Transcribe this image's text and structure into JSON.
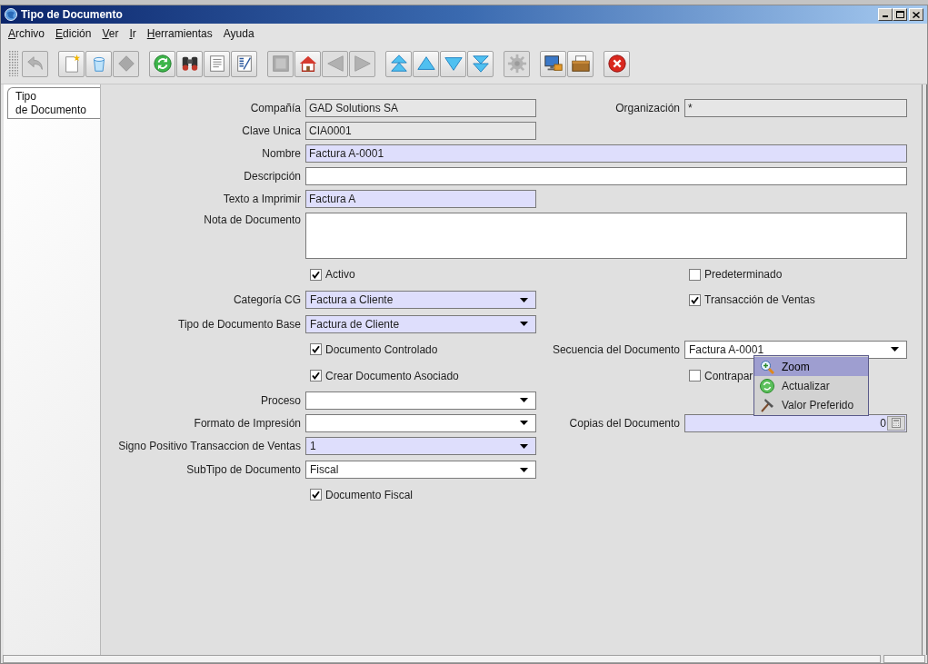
{
  "window": {
    "title": "Tipo de Documento"
  },
  "menu_bar": [
    {
      "label": "Archivo",
      "mnemonic_underlined": true
    },
    {
      "label": "Edición",
      "mnemonic_underlined": true
    },
    {
      "label": "Ver",
      "mnemonic_underlined": true
    },
    {
      "label": "Ir",
      "mnemonic_underlined": true
    },
    {
      "label": "Herramientas",
      "mnemonic_underlined": true
    },
    {
      "label": "Ayuda",
      "mnemonic_underlined": false
    }
  ],
  "toolbar": {
    "groups": [
      {
        "buttons": [
          {
            "kind": "undo",
            "disabled": true
          }
        ]
      },
      {
        "buttons": [
          {
            "kind": "new",
            "disabled": false
          },
          {
            "kind": "delete",
            "disabled": false
          },
          {
            "kind": "save",
            "disabled": true
          }
        ]
      },
      {
        "buttons": [
          {
            "kind": "refresh",
            "disabled": false
          },
          {
            "kind": "find",
            "disabled": false
          },
          {
            "kind": "history",
            "disabled": false
          },
          {
            "kind": "report",
            "disabled": false
          }
        ]
      },
      {
        "buttons": [
          {
            "kind": "attachment",
            "disabled": true
          },
          {
            "kind": "parent",
            "disabled": false
          },
          {
            "kind": "previous-tab",
            "disabled": true
          },
          {
            "kind": "next-tab",
            "disabled": true
          }
        ]
      },
      {
        "buttons": [
          {
            "kind": "first",
            "disabled": false
          },
          {
            "kind": "previous",
            "disabled": false
          },
          {
            "kind": "next",
            "disabled": false
          },
          {
            "kind": "last",
            "disabled": false
          }
        ]
      },
      {
        "buttons": [
          {
            "kind": "workflow",
            "disabled": true
          }
        ]
      },
      {
        "buttons": [
          {
            "kind": "export",
            "disabled": false
          },
          {
            "kind": "archive",
            "disabled": false
          }
        ]
      },
      {
        "buttons": [
          {
            "kind": "exit",
            "disabled": false
          }
        ]
      }
    ]
  },
  "tabs": [
    {
      "label": "Tipo\nde Documento",
      "selected": true
    }
  ],
  "form": {
    "rows": [
      {
        "left": {
          "kind": "text",
          "label": "Compañía",
          "value": "GAD Solutions SA",
          "mandatory": false,
          "read_only": true
        },
        "right": {
          "kind": "text",
          "label": "Organización",
          "value": "*",
          "mandatory": false,
          "read_only": true
        }
      },
      {
        "left": {
          "kind": "text",
          "label": "Clave Unica",
          "value": "CIA0001",
          "mandatory": false,
          "read_only": true
        }
      },
      {
        "left": {
          "kind": "text",
          "label": "Nombre",
          "value": "Factura A-0001",
          "mandatory": true,
          "read_only": false
        }
      },
      {
        "left": {
          "kind": "text",
          "label": "Descripción",
          "mandatory": false,
          "read_only": false
        }
      },
      {
        "left": {
          "kind": "text",
          "label": "Texto a Imprimir",
          "value": "Factura A",
          "mandatory": true,
          "read_only": false
        }
      },
      {
        "left": {
          "kind": "textarea",
          "label": "Nota de Documento",
          "mandatory": false,
          "read_only": false
        }
      },
      {
        "left": {
          "kind": "checkbox",
          "label": "Activo",
          "checked": true
        },
        "right": {
          "kind": "checkbox",
          "label": "Predeterminado",
          "checked": false
        }
      },
      {
        "left": {
          "kind": "combo",
          "label": "Categoría CG",
          "value": "Factura a Cliente",
          "mandatory": true,
          "read_only": false
        },
        "right": {
          "kind": "checkbox",
          "label": "Transacción de Ventas",
          "checked": true
        }
      },
      {
        "left": {
          "kind": "combo",
          "label": "Tipo de Documento Base",
          "value": "Factura de Cliente",
          "mandatory": true,
          "read_only": false
        }
      },
      {
        "left": {
          "kind": "checkbox",
          "label": "Documento Controlado",
          "checked": true
        },
        "right": {
          "kind": "combo",
          "label": "Secuencia del Documento",
          "value": "Factura A-0001",
          "mandatory": false,
          "read_only": false
        }
      },
      {
        "left": {
          "kind": "checkbox",
          "label": "Crear Documento Asociado",
          "checked": true
        },
        "right": {
          "kind": "checkbox",
          "label": "Contrapar",
          "checked": false
        }
      },
      {
        "left": {
          "kind": "combo",
          "label": "Proceso",
          "mandatory": false,
          "read_only": false
        }
      },
      {
        "left": {
          "kind": "combo",
          "label": "Formato de Impresión",
          "mandatory": false,
          "read_only": false
        },
        "right": {
          "kind": "number",
          "label": "Copias del Documento",
          "value": "0",
          "mandatory": true,
          "read_only": false
        }
      },
      {
        "left": {
          "kind": "combo",
          "label": "Signo Positivo Transaccion de Ventas",
          "value": "1",
          "mandatory": true,
          "read_only": false
        }
      },
      {
        "left": {
          "kind": "combo",
          "label": "SubTipo de Documento",
          "value": "Fiscal",
          "mandatory": false,
          "read_only": false
        }
      },
      {
        "left": {
          "kind": "checkbox",
          "label": "Documento Fiscal",
          "checked": true
        }
      }
    ]
  },
  "context_menu": {
    "items": [
      {
        "kind": "zoom",
        "label": "Zoom",
        "selected": true
      },
      {
        "kind": "refresh",
        "label": "Actualizar",
        "selected": false
      },
      {
        "kind": "default",
        "label": "Valor Preferido",
        "selected": false
      }
    ]
  }
}
